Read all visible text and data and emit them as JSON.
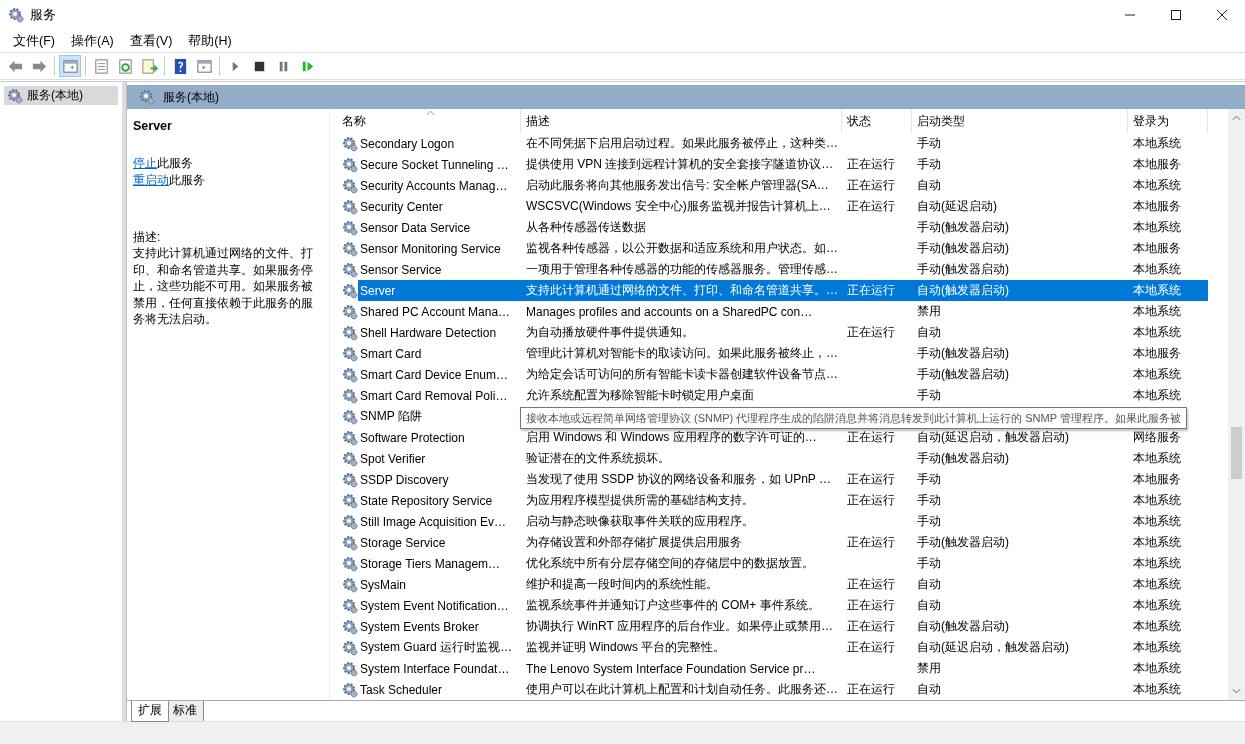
{
  "window": {
    "title": "服务"
  },
  "menu": [
    "文件(F)",
    "操作(A)",
    "查看(V)",
    "帮助(H)"
  ],
  "toolbar": [
    {
      "kind": "back",
      "on": false
    },
    {
      "kind": "forward",
      "on": false
    },
    {
      "kind": "tree",
      "on": true
    },
    {
      "kind": "properties",
      "on": false
    },
    {
      "kind": "refresh",
      "on": false
    },
    {
      "kind": "export",
      "on": false
    },
    {
      "kind": "help",
      "on": false
    },
    {
      "kind": "view",
      "on": false
    },
    {
      "kind": "play",
      "on": false
    },
    {
      "kind": "stop",
      "on": false
    },
    {
      "kind": "pause",
      "on": false
    },
    {
      "kind": "resume",
      "on": false
    }
  ],
  "tree": [
    {
      "label": "服务(本地)",
      "selected": true
    }
  ],
  "pane_title": "服务(本地)",
  "details": {
    "title": "Server",
    "actions": [
      {
        "link": "停止",
        "text": "此服务"
      },
      {
        "link": "重启动",
        "text": "此服务"
      }
    ],
    "description_label": "描述:",
    "description": "支持此计算机通过网络的文件、打印、和命名管道共享。如果服务停止，这些功能不可用。如果服务被禁用，任何直接依赖于此服务的服务将无法启动。"
  },
  "columns": [
    {
      "label": "名称",
      "sorted": true
    },
    {
      "label": "描述",
      "sorted": false
    },
    {
      "label": "状态",
      "sorted": false
    },
    {
      "label": "启动类型",
      "sorted": false
    },
    {
      "label": "登录为",
      "sorted": false
    }
  ],
  "rows": [
    {
      "name": "Secondary Logon",
      "description": "在不同凭据下启用启动过程。如果此服务被停止，这种类…",
      "status": "",
      "startup": "手动",
      "logon": "本地系统",
      "selected": false
    },
    {
      "name": "Secure Socket Tunneling …",
      "description": "提供使用 VPN 连接到远程计算机的安全套接字隧道协议…",
      "status": "正在运行",
      "startup": "手动",
      "logon": "本地服务",
      "selected": false
    },
    {
      "name": "Security Accounts Manag…",
      "description": "启动此服务将向其他服务发出信号: 安全帐户管理器(SA…",
      "status": "正在运行",
      "startup": "自动",
      "logon": "本地系统",
      "selected": false
    },
    {
      "name": "Security Center",
      "description": "WSCSVC(Windows 安全中心)服务监视并报告计算机上…",
      "status": "正在运行",
      "startup": "自动(延迟启动)",
      "logon": "本地服务",
      "selected": false
    },
    {
      "name": "Sensor Data Service",
      "description": "从各种传感器传送数据",
      "status": "",
      "startup": "手动(触发器启动)",
      "logon": "本地系统",
      "selected": false
    },
    {
      "name": "Sensor Monitoring Service",
      "description": "监视各种传感器，以公开数据和适应系统和用户状态。如…",
      "status": "",
      "startup": "手动(触发器启动)",
      "logon": "本地服务",
      "selected": false
    },
    {
      "name": "Sensor Service",
      "description": "一项用于管理各种传感器的功能的传感器服务。管理传感…",
      "status": "",
      "startup": "手动(触发器启动)",
      "logon": "本地系统",
      "selected": false
    },
    {
      "name": "Server",
      "description": "支持此计算机通过网络的文件、打印、和命名管道共享。…",
      "status": "正在运行",
      "startup": "自动(触发器启动)",
      "logon": "本地系统",
      "selected": true
    },
    {
      "name": "Shared PC Account Mana…",
      "description": "Manages profiles and accounts on a SharedPC con…",
      "status": "",
      "startup": "禁用",
      "logon": "本地系统",
      "selected": false
    },
    {
      "name": "Shell Hardware Detection",
      "description": "为自动播放硬件事件提供通知。",
      "status": "正在运行",
      "startup": "自动",
      "logon": "本地系统",
      "selected": false
    },
    {
      "name": "Smart Card",
      "description": "管理此计算机对智能卡的取读访问。如果此服务被终止，…",
      "status": "",
      "startup": "手动(触发器启动)",
      "logon": "本地服务",
      "selected": false
    },
    {
      "name": "Smart Card Device Enum…",
      "description": "为给定会话可访问的所有智能卡读卡器创建软件设备节点…",
      "status": "",
      "startup": "手动(触发器启动)",
      "logon": "本地系统",
      "selected": false
    },
    {
      "name": "Smart Card Removal Poli…",
      "description": "允许系统配置为移除智能卡时锁定用户桌面",
      "status": "",
      "startup": "手动",
      "logon": "本地系统",
      "selected": false
    },
    {
      "name": "SNMP 陷阱",
      "tooltip": "接收本地或远程简单网络管理协议 (SNMP) 代理程序生成的陷阱消息并将消息转发到此计算机上运行的 SNMP 管理程序。如果此服务被",
      "selected": false
    },
    {
      "name": "Software Protection",
      "description": "启用 Windows 和 Windows 应用程序的数字许可证的…",
      "status": "正在运行",
      "startup": "自动(延迟启动，触发器启动)",
      "logon": "网络服务",
      "selected": false
    },
    {
      "name": "Spot Verifier",
      "description": "验证潜在的文件系统损坏。",
      "status": "",
      "startup": "手动(触发器启动)",
      "logon": "本地系统",
      "selected": false
    },
    {
      "name": "SSDP Discovery",
      "description": "当发现了使用 SSDP 协议的网络设备和服务，如 UPnP …",
      "status": "正在运行",
      "startup": "手动",
      "logon": "本地服务",
      "selected": false
    },
    {
      "name": "State Repository Service",
      "description": "为应用程序模型提供所需的基础结构支持。",
      "status": "正在运行",
      "startup": "手动",
      "logon": "本地系统",
      "selected": false
    },
    {
      "name": "Still Image Acquisition Ev…",
      "description": "启动与静态映像获取事件关联的应用程序。",
      "status": "",
      "startup": "手动",
      "logon": "本地系统",
      "selected": false
    },
    {
      "name": "Storage Service",
      "description": "为存储设置和外部存储扩展提供启用服务",
      "status": "正在运行",
      "startup": "手动(触发器启动)",
      "logon": "本地系统",
      "selected": false
    },
    {
      "name": "Storage Tiers Managem…",
      "description": "优化系统中所有分层存储空间的存储层中的数据放置。",
      "status": "",
      "startup": "手动",
      "logon": "本地系统",
      "selected": false
    },
    {
      "name": "SysMain",
      "description": "维护和提高一段时间内的系统性能。",
      "status": "正在运行",
      "startup": "自动",
      "logon": "本地系统",
      "selected": false
    },
    {
      "name": "System Event Notification…",
      "description": "监视系统事件并通知订户这些事件的 COM+ 事件系统。",
      "status": "正在运行",
      "startup": "自动",
      "logon": "本地系统",
      "selected": false
    },
    {
      "name": "System Events Broker",
      "description": "协调执行 WinRT 应用程序的后台作业。如果停止或禁用…",
      "status": "正在运行",
      "startup": "自动(触发器启动)",
      "logon": "本地系统",
      "selected": false
    },
    {
      "name": "System Guard 运行时监视…",
      "description": "监视并证明 Windows 平台的完整性。",
      "status": "正在运行",
      "startup": "自动(延迟启动，触发器启动)",
      "logon": "本地系统",
      "selected": false
    },
    {
      "name": "System Interface Foundat…",
      "description": "The Lenovo System Interface Foundation Service pr…",
      "status": "",
      "startup": "禁用",
      "logon": "本地系统",
      "selected": false
    },
    {
      "name": "Task Scheduler",
      "description": "使用户可以在此计算机上配置和计划自动任务。此服务还…",
      "status": "正在运行",
      "startup": "自动",
      "logon": "本地系统",
      "selected": false
    }
  ],
  "view_tabs": [
    {
      "label": "扩展",
      "selected": true
    },
    {
      "label": "标准",
      "selected": false
    }
  ]
}
